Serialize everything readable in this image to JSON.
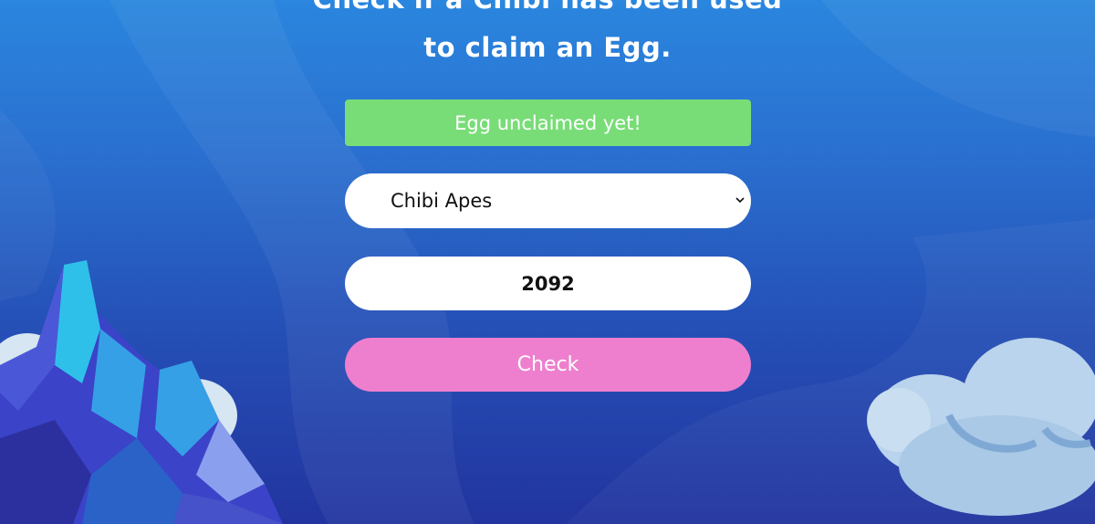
{
  "header": {
    "title_line1": "Check if a Chibi has been used",
    "title_line2": "to claim an Egg."
  },
  "status": {
    "message": "Egg unclaimed yet!",
    "color": "#78dd77"
  },
  "collection_select": {
    "selected": "Chibi Apes",
    "icon": "chevron-down-icon"
  },
  "token_input": {
    "value": "2092"
  },
  "check_button": {
    "label": "Check",
    "color": "#ee7fce"
  },
  "colors": {
    "background_top": "#2a86de",
    "background_bottom": "#22349f"
  }
}
